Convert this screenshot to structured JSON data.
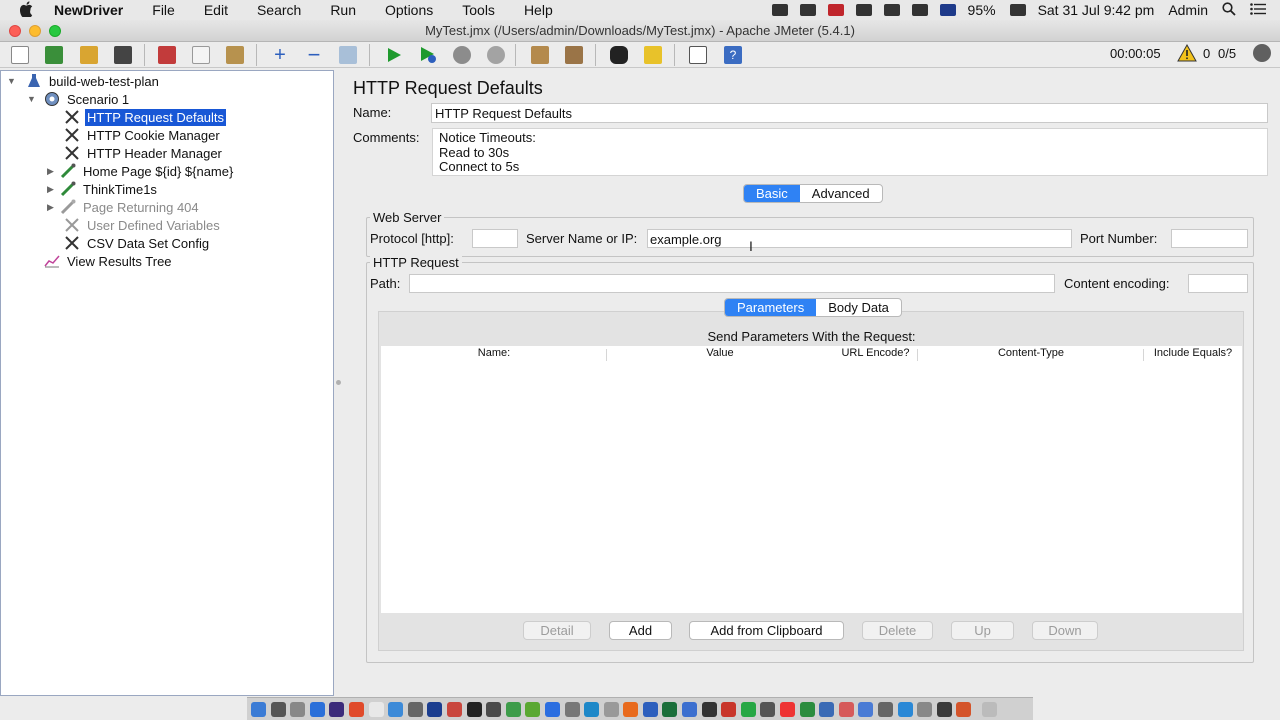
{
  "menubar": {
    "app_name": "NewDriver",
    "items": [
      "File",
      "Edit",
      "Search",
      "Run",
      "Options",
      "Tools",
      "Help"
    ],
    "battery": "95%",
    "clock": "Sat 31 Jul  9:42 pm",
    "user": "Admin"
  },
  "window": {
    "title": "MyTest.jmx (/Users/admin/Downloads/MyTest.jmx) - Apache JMeter (5.4.1)"
  },
  "toolbar": {
    "elapsed": "00:00:05",
    "warnings": "0",
    "threads": "0/5"
  },
  "tree": {
    "plan": "build-web-test-plan",
    "scenario": "Scenario 1",
    "items": [
      {
        "label": "HTTP Request Defaults",
        "icon": "wrench-icon",
        "selected": true
      },
      {
        "label": "HTTP Cookie Manager",
        "icon": "wrench-icon"
      },
      {
        "label": "HTTP Header Manager",
        "icon": "wrench-icon"
      },
      {
        "label": "Home Page ${id} ${name}",
        "icon": "pipette-icon"
      },
      {
        "label": "ThinkTime1s",
        "icon": "pipette-icon"
      },
      {
        "label": "Page Returning 404",
        "icon": "pipette-icon",
        "disabled": true
      },
      {
        "label": "User Defined Variables",
        "icon": "wrench-icon",
        "disabled": true
      },
      {
        "label": "CSV Data Set Config",
        "icon": "wrench-icon"
      }
    ],
    "listener": "View Results Tree"
  },
  "panel": {
    "title": "HTTP Request Defaults",
    "name_label": "Name:",
    "name_value": "HTTP Request Defaults",
    "comments_label": "Comments:",
    "comments_lines": [
      "Notice Timeouts:",
      "Read to 30s",
      "Connect to 5s"
    ],
    "tabs": {
      "basic": "Basic",
      "advanced": "Advanced"
    },
    "web_server": {
      "legend": "Web Server",
      "protocol_label": "Protocol [http]:",
      "protocol_value": "",
      "server_label": "Server Name or IP:",
      "server_value": "example.org",
      "port_label": "Port Number:",
      "port_value": ""
    },
    "http_request": {
      "legend": "HTTP Request",
      "path_label": "Path:",
      "path_value": "",
      "encoding_label": "Content encoding:",
      "encoding_value": ""
    },
    "subtabs": {
      "parameters": "Parameters",
      "body": "Body Data"
    },
    "params_title": "Send Parameters With the Request:",
    "columns": [
      "Name:",
      "Value",
      "URL Encode?",
      "Content-Type",
      "Include Equals?"
    ],
    "buttons": {
      "detail": "Detail",
      "add": "Add",
      "clipboard": "Add from Clipboard",
      "delete": "Delete",
      "up": "Up",
      "down": "Down"
    }
  },
  "colors": {
    "selection": "#1857d6",
    "tab_active": "#2f82f4"
  }
}
